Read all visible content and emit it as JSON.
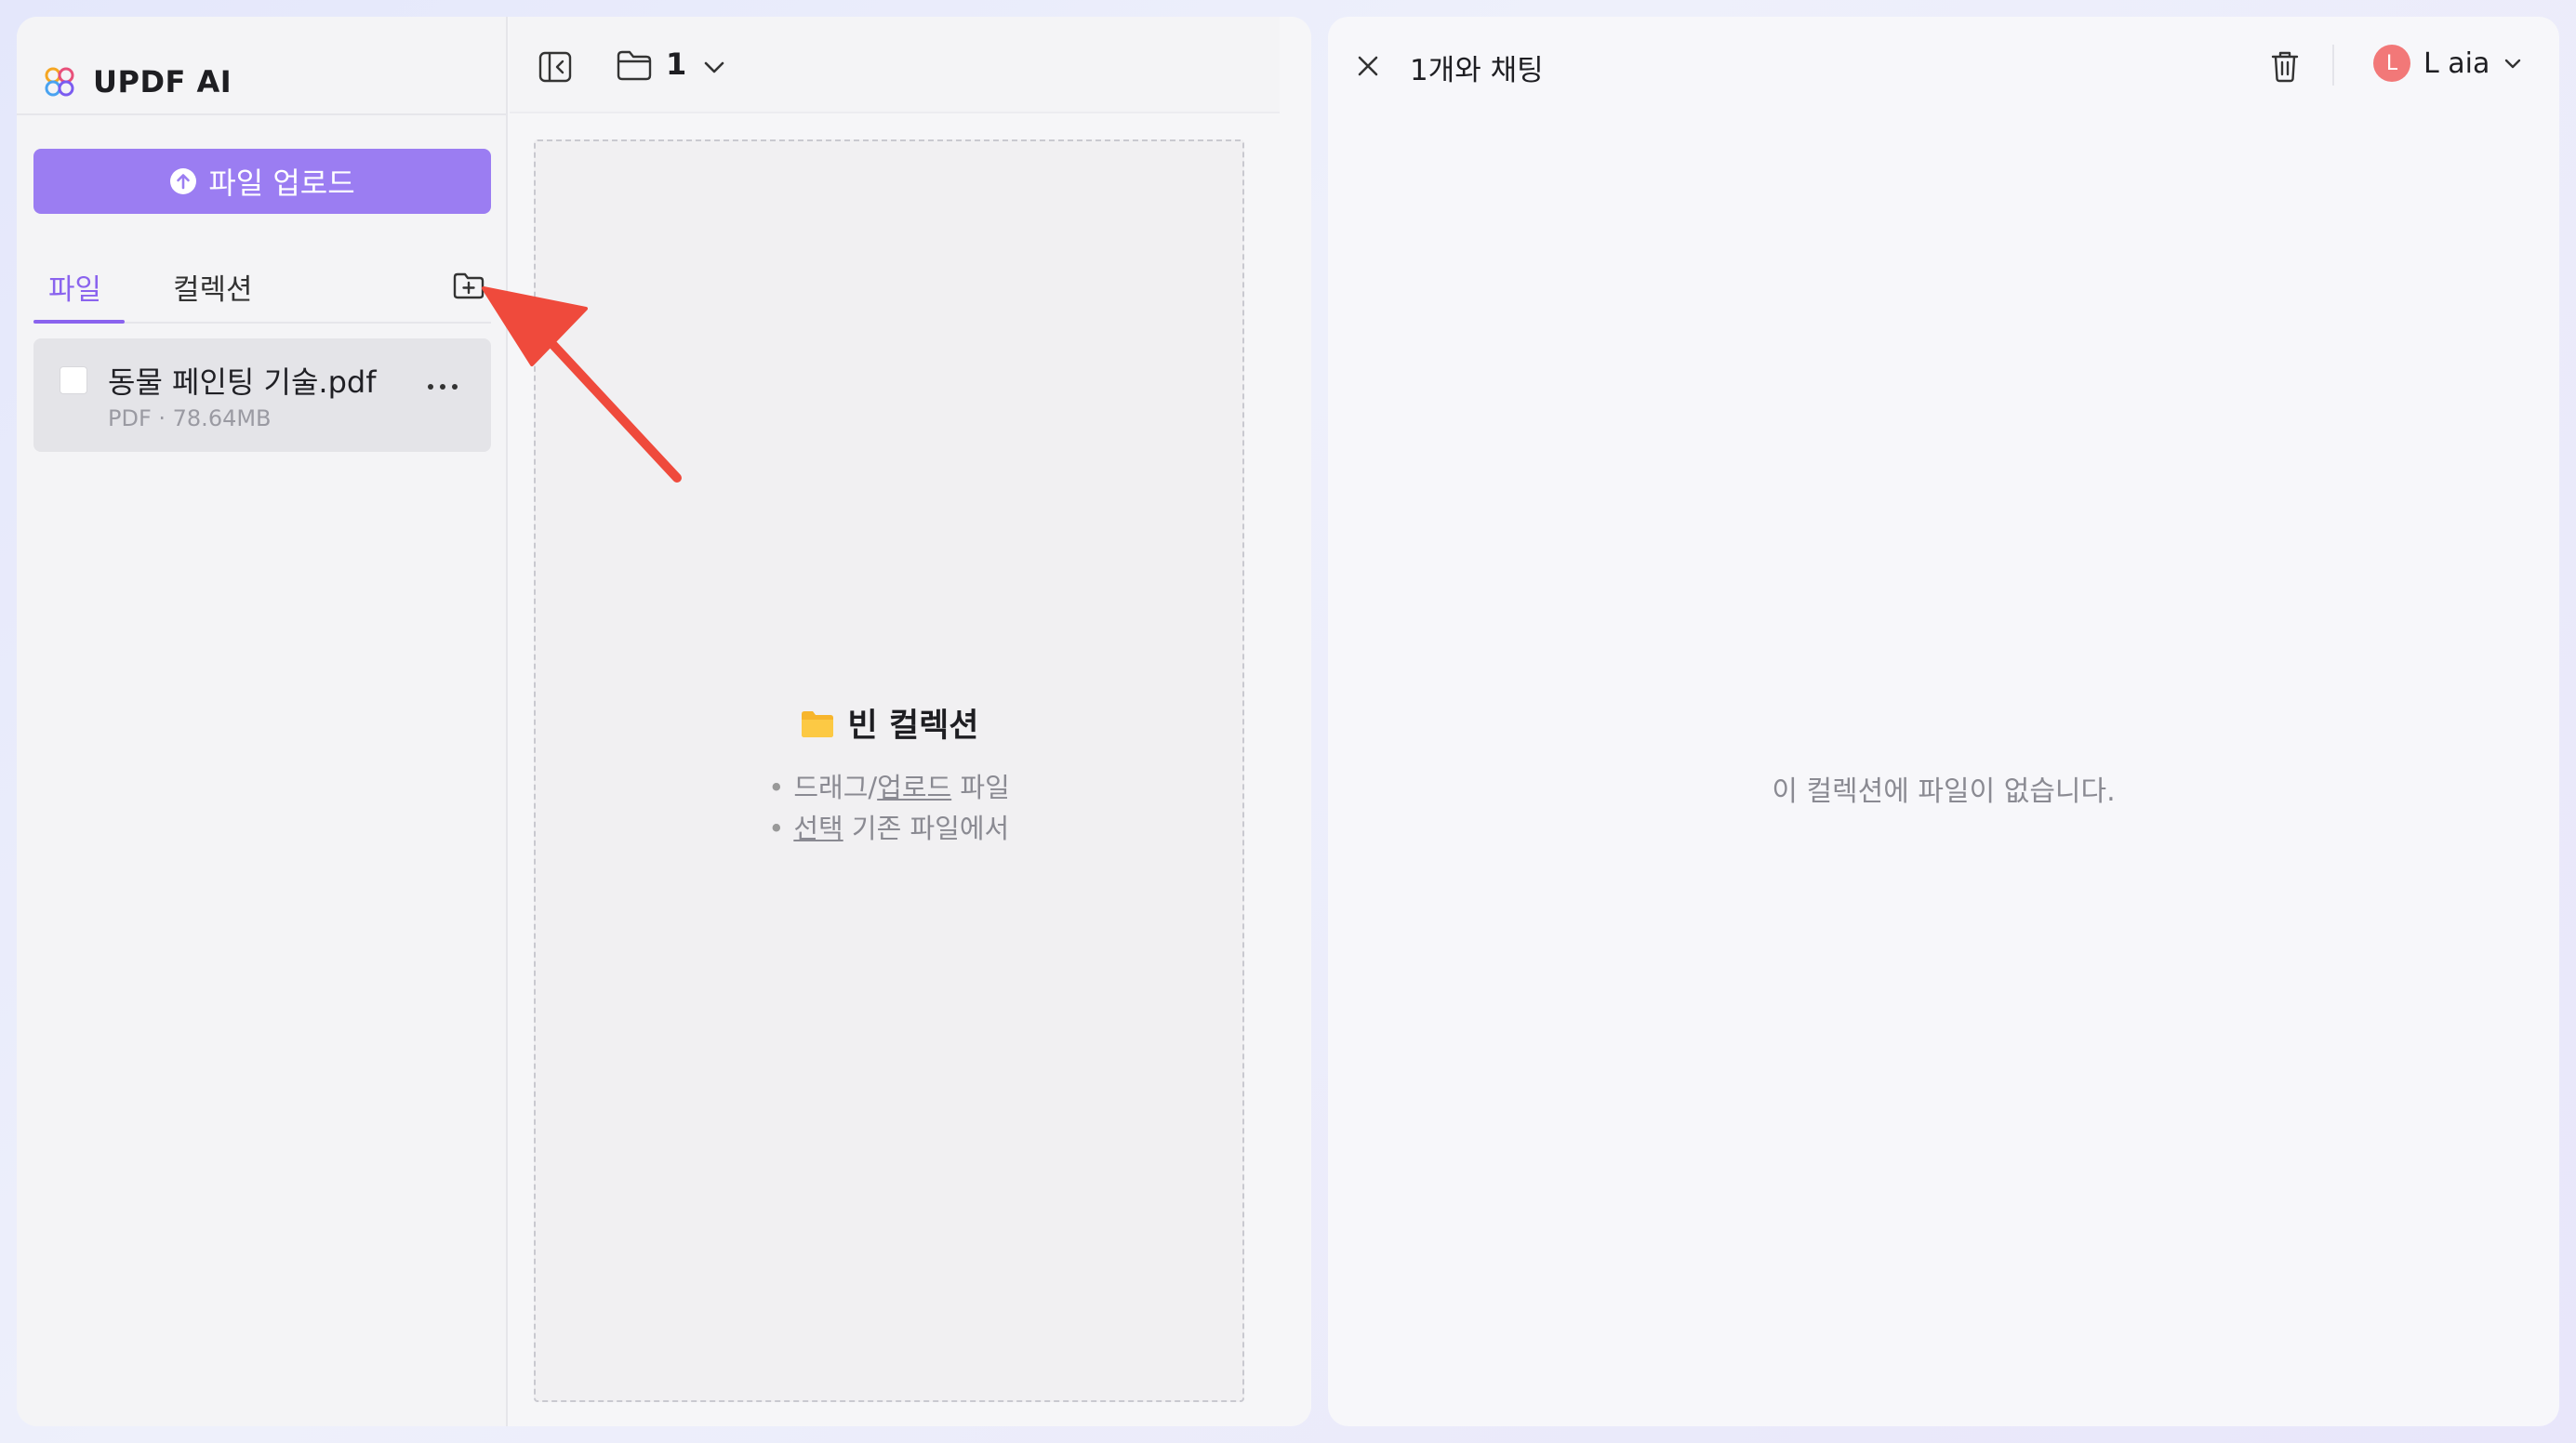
{
  "app": {
    "name": "UPDF AI"
  },
  "sidebar": {
    "upload_label": "파일 업로드",
    "tabs": [
      {
        "label": "파일",
        "active": true
      },
      {
        "label": "컬렉션",
        "active": false
      }
    ],
    "files": [
      {
        "name": "동물 페인팅 기술.pdf",
        "meta": "PDF · 78.64MB",
        "checked": false
      }
    ]
  },
  "middle": {
    "folder_count": "1",
    "empty": {
      "title": "빈 컬렉션",
      "line1_a": "드래그/",
      "line1_link": "업로드",
      "line1_b": " 파일",
      "line2_link": "선택",
      "line2_b": " 기존 파일에서"
    }
  },
  "chat": {
    "title": "1개와 채팅",
    "user_initial": "L",
    "user_name": "L aia",
    "empty_message": "이 컬렉션에 파일이 없습니다."
  },
  "colors": {
    "accent": "#9b7df2",
    "accent_text": "#8a63ee",
    "avatar": "#f27878",
    "annotation_arrow": "#ef4a3c"
  },
  "icons": {
    "logo": "updf-logo-icon",
    "upload": "upload-arrow-icon",
    "new_folder": "folder-plus-icon",
    "more": "more-dots-icon",
    "collapse": "sidebar-collapse-icon",
    "folder": "folder-icon",
    "chevron": "chevron-down-icon",
    "close": "close-icon",
    "trash": "trash-icon"
  }
}
